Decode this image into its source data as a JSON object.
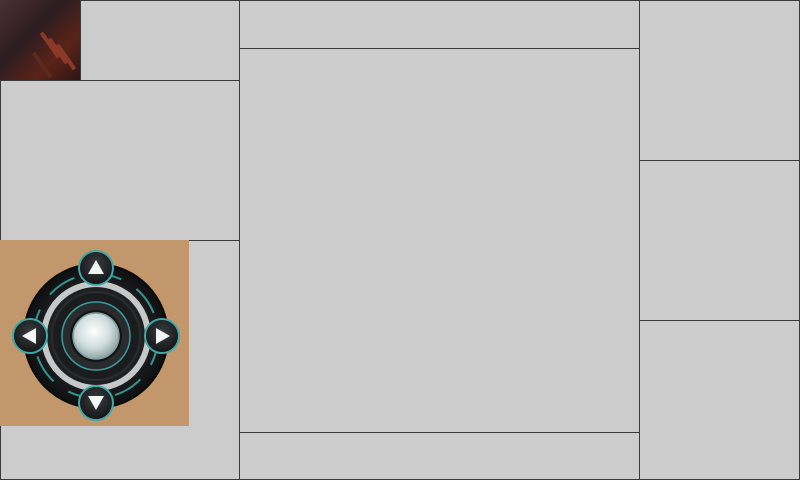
{
  "colors": {
    "panel_bg": "#cccccc",
    "panel_border": "#3a3a3a",
    "dpad_backdrop": "#c2976c",
    "dpad_ring_dark": "#1c1e20",
    "dpad_accent": "#3fa8a8",
    "dpad_button_fill": "#e8efef"
  },
  "icons": {
    "thumbnail": "character-portrait-icon",
    "up": "arrow-up-icon",
    "down": "arrow-down-icon",
    "left": "arrow-left-icon",
    "right": "arrow-right-icon",
    "center": "center-action-button-icon"
  }
}
